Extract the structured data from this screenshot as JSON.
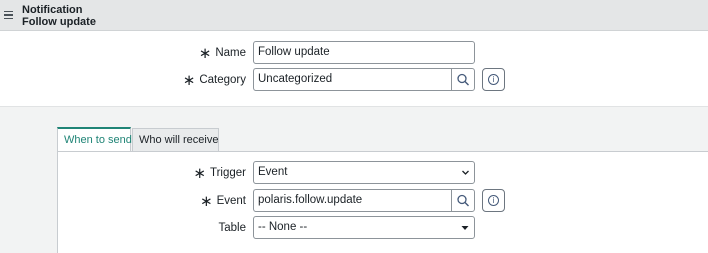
{
  "header": {
    "title_line1": "Notification",
    "title_line2": "Follow update"
  },
  "form": {
    "name": {
      "label": "Name",
      "value": "Follow update",
      "required": true
    },
    "category": {
      "label": "Category",
      "value": "Uncategorized",
      "required": true
    }
  },
  "tabs": [
    {
      "label": "When to send",
      "active": true
    },
    {
      "label": "Who will receive",
      "active": false
    }
  ],
  "when_to_send": {
    "trigger": {
      "label": "Trigger",
      "value": "Event",
      "required": true
    },
    "event": {
      "label": "Event",
      "value": "polaris.follow.update",
      "required": true
    },
    "table": {
      "label": "Table",
      "value": "-- None --",
      "required": false
    }
  },
  "icons": {
    "menu": "hamburger-menu-icon",
    "search": "search-icon",
    "info": "info-icon",
    "dropdown": "chevron-down-icon"
  },
  "colors": {
    "accent": "#1f8476",
    "header_bg": "#e4e6e7",
    "info_icon": "#455a7a"
  }
}
